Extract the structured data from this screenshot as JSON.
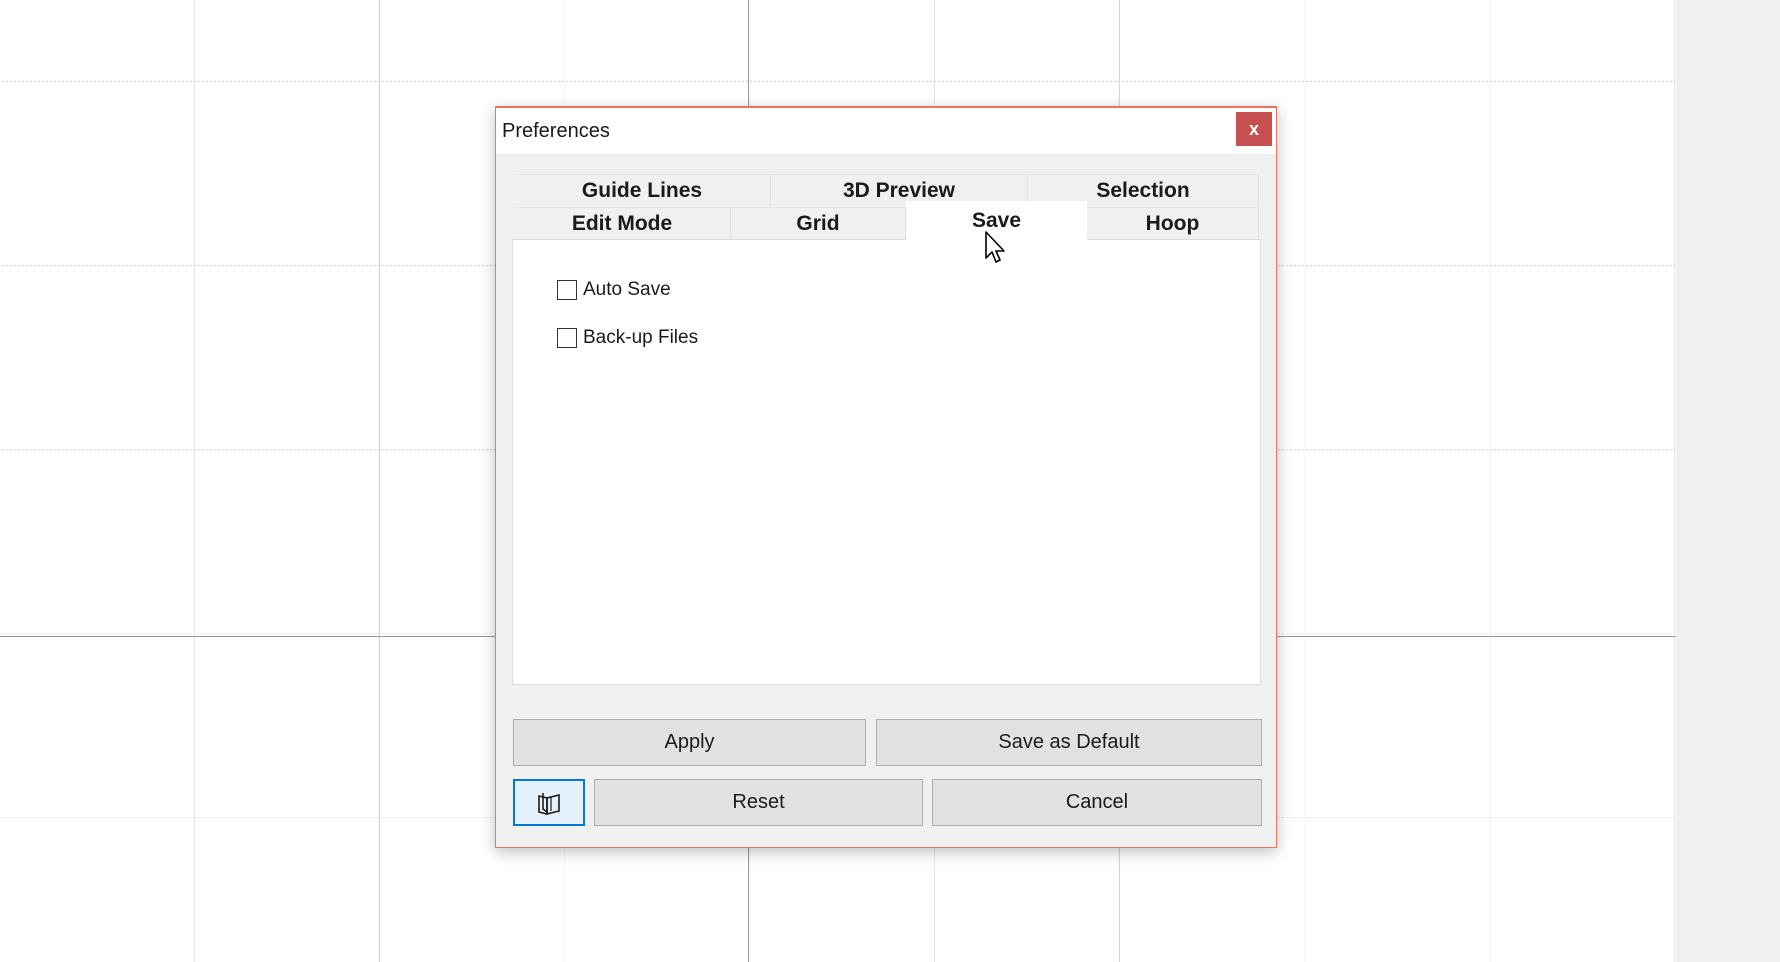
{
  "dialog": {
    "title": "Preferences",
    "close_label": "x"
  },
  "tabs": {
    "row1": [
      {
        "label": "Guide Lines"
      },
      {
        "label": "3D Preview"
      },
      {
        "label": "Selection"
      }
    ],
    "row2": [
      {
        "label": "Edit Mode"
      },
      {
        "label": "Grid"
      },
      {
        "label": "Save",
        "active": true
      },
      {
        "label": "Hoop"
      }
    ]
  },
  "save_tab": {
    "auto_save": {
      "label": "Auto Save",
      "checked": false
    },
    "backup_files": {
      "label": "Back-up Files",
      "checked": false
    }
  },
  "buttons": {
    "apply": "Apply",
    "save_default": "Save as Default",
    "help_icon": "help-book-icon",
    "reset": "Reset",
    "cancel": "Cancel"
  },
  "colors": {
    "close_button": "#c75050",
    "focus_border": "#0078d7",
    "dialog_border": "#e8765f"
  }
}
